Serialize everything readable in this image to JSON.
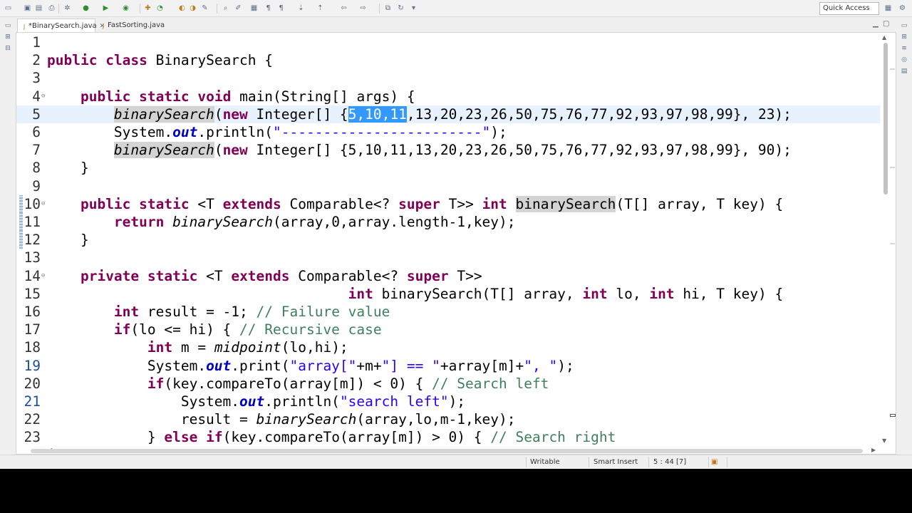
{
  "toolbar": {
    "quick_access": "Quick Access",
    "icons": [
      "new-icon",
      "save-icon",
      "save-all-icon",
      "print-icon",
      "toggle-breakpoint-icon",
      "debug-icon",
      "run-icon",
      "external-tools-icon",
      "coverage-icon",
      "new-java-project-icon",
      "new-package-icon",
      "new-class-icon",
      "open-type-icon",
      "open-task-icon",
      "search-icon",
      "mark-occurrences-icon",
      "annotation-icon",
      "show-whitespace-icon",
      "next-annotation-icon",
      "previous-annotation-icon",
      "back-icon",
      "forward-icon",
      "pin-editor-icon"
    ]
  },
  "tabs": [
    {
      "label": "*BinarySearch.java",
      "active": true
    },
    {
      "label": "FastSorting.java",
      "active": false
    }
  ],
  "editor": {
    "lines": [
      {
        "n": "1",
        "code": ""
      },
      {
        "n": "2",
        "code": "public class BinarySearch {"
      },
      {
        "n": "3",
        "code": ""
      },
      {
        "n": "4",
        "code": "    public static void main(String[] args) {"
      },
      {
        "n": "5",
        "code": "        binarySearch(new Integer[] {5,10,11,13,20,23,26,50,75,76,77,92,93,97,98,99}, 23);"
      },
      {
        "n": "6",
        "code": "        System.out.println(\"------------------------\");"
      },
      {
        "n": "7",
        "code": "        binarySearch(new Integer[] {5,10,11,13,20,23,26,50,75,76,77,92,93,97,98,99}, 90);"
      },
      {
        "n": "8",
        "code": "    }"
      },
      {
        "n": "9",
        "code": ""
      },
      {
        "n": "10",
        "code": "    public static <T extends Comparable<? super T>> int binarySearch(T[] array, T key) {"
      },
      {
        "n": "11",
        "code": "        return binarySearch(array,0,array.length-1,key);"
      },
      {
        "n": "12",
        "code": "    }"
      },
      {
        "n": "13",
        "code": ""
      },
      {
        "n": "14",
        "code": "    private static <T extends Comparable<? super T>>"
      },
      {
        "n": "15",
        "code": "                                    int binarySearch(T[] array, int lo, int hi, T key) {"
      },
      {
        "n": "16",
        "code": "        int result = -1; // Failure value"
      },
      {
        "n": "17",
        "code": "        if(lo <= hi) { // Recursive case"
      },
      {
        "n": "18",
        "code": "            int m = midpoint(lo,hi);"
      },
      {
        "n": "19",
        "code": "            System.out.print(\"array[\"+m+\"] == \"+array[m]+\", \");"
      },
      {
        "n": "20",
        "code": "            if(key.compareTo(array[m]) < 0) { // Search left"
      },
      {
        "n": "21",
        "code": "                System.out.println(\"search left\");"
      },
      {
        "n": "22",
        "code": "                result = binarySearch(array,lo,m-1,key);"
      },
      {
        "n": "23",
        "code": "            } else if(key.compareTo(array[m]) > 0) { // Search right"
      }
    ],
    "selected_text": "5,10,11"
  },
  "status": {
    "mode": "Writable",
    "insert_mode": "Smart Insert",
    "position": "5 : 44 [7]"
  }
}
